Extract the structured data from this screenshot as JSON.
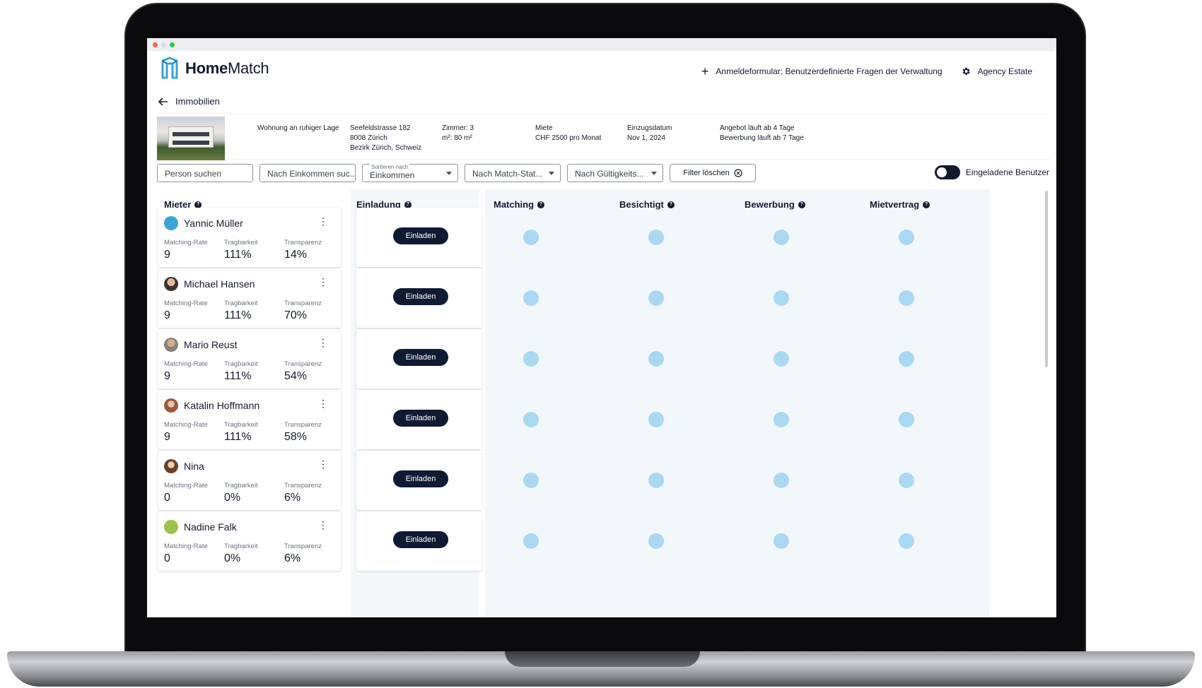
{
  "app": {
    "logo_bold": "Home",
    "logo_regular": "Match",
    "custom_form_link": "Anmeldeformular: Benutzerdefinierte Fragen der Verwaltung",
    "agency_name": "Agency Estate",
    "back_label": "Immobilien"
  },
  "property": {
    "title": "Wohnung an ruhiger Lage",
    "address_line1": "Seefeldstrasse 182",
    "address_line2": "8008 Zürich",
    "address_line3": "Bezirk Zürich, Schweiz",
    "rooms": "Zimmer: 3",
    "area": "m²: 80 m²",
    "rent_label": "Miete",
    "rent_value": "CHF 2500 pro Monat",
    "move_in_label": "Einzugsdatum",
    "move_in_value": "Nov 1, 2024",
    "offer_runs": "Angebot läuft ab 4 Tage",
    "application_runs": "Bewerbung läuft ab 7 Tage"
  },
  "filters": {
    "search_person": "Person suchen",
    "search_income": "Nach Einkommen suc...",
    "sort_label": "Sortieren nach",
    "sort_value": "Einkommen",
    "match_status": "Nach Match-Stat...",
    "validity": "Nach Gültigkeits...",
    "clear_label": "Filter löschen",
    "invited_users_label": "Eingeladene Benutzer"
  },
  "columns": {
    "tenants": "Mieter",
    "invitation": "Einladung",
    "matching": "Matching",
    "viewed": "Besichtigt",
    "application": "Bewerbung",
    "lease": "Mietvertrag"
  },
  "metric_labels": {
    "matching_rate": "Matching-Rate",
    "affordability": "Tragbarkeit",
    "transparency": "Transparenz"
  },
  "invite_label": "Einladen",
  "tenants": [
    {
      "name": "Yannic Müller",
      "matching_rate": "9",
      "affordability": "111%",
      "transparency": "14%"
    },
    {
      "name": "Michael Hansen",
      "matching_rate": "9",
      "affordability": "111%",
      "transparency": "70%"
    },
    {
      "name": "Mario Reust",
      "matching_rate": "9",
      "affordability": "111%",
      "transparency": "54%"
    },
    {
      "name": "Katalin Hoffmann",
      "matching_rate": "9",
      "affordability": "111%",
      "transparency": "58%"
    },
    {
      "name": "Nina",
      "matching_rate": "0",
      "affordability": "0%",
      "transparency": "6%"
    },
    {
      "name": "Nadine Falk",
      "matching_rate": "0",
      "affordability": "0%",
      "transparency": "6%"
    }
  ],
  "colors": {
    "primary": "#0f1a33",
    "lane_background": "#f2f7fc",
    "stage_dot": "#a9d8f2",
    "logo_accent": "#3aa3d8"
  },
  "icons": {
    "back": "arrow-left-icon",
    "add": "plus-icon",
    "settings": "gear-icon",
    "help": "question-circle-icon",
    "more": "kebab-menu-icon",
    "clear": "close-circle-icon"
  }
}
